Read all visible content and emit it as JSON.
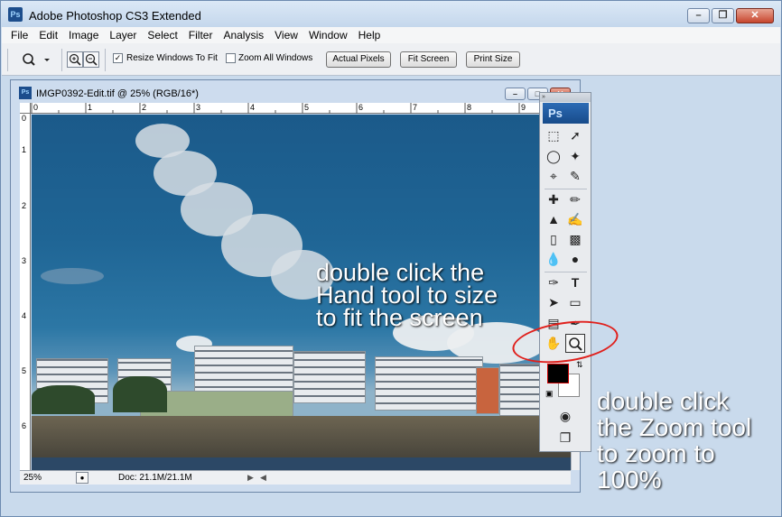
{
  "app": {
    "title": "Adobe Photoshop CS3 Extended",
    "icon_label": "Ps"
  },
  "menu": [
    "File",
    "Edit",
    "Image",
    "Layer",
    "Select",
    "Filter",
    "Analysis",
    "View",
    "Window",
    "Help"
  ],
  "options": {
    "resize_windows": {
      "label": "Resize Windows To Fit",
      "checked": true
    },
    "zoom_all": {
      "label": "Zoom All Windows",
      "checked": false
    },
    "actual_pixels": "Actual Pixels",
    "fit_screen": "Fit Screen",
    "print_size": "Print Size"
  },
  "document": {
    "icon_label": "Ps",
    "title": "IMGP0392-Edit.tif @ 25% (RGB/16*)",
    "ruler_top": [
      "0",
      "1",
      "2",
      "3",
      "4",
      "5",
      "6",
      "7",
      "8",
      "9"
    ],
    "ruler_left": [
      "0",
      "1",
      "2",
      "3",
      "4",
      "5",
      "6"
    ],
    "status_zoom": "25%",
    "status_doc": "Doc: 21.1M/21.1M"
  },
  "annotations": {
    "hand_line1": "double click the",
    "hand_line2": "Hand tool to size",
    "hand_line3": "to fit the screen",
    "zoom_line1": "double click",
    "zoom_line2": "the Zoom tool",
    "zoom_line3": "to zoom to",
    "zoom_line4": "100%"
  },
  "toolbox": {
    "logo": "Ps",
    "grip": "»",
    "foreground_color": "#000000",
    "background_color": "#ffffff"
  },
  "colors": {
    "highlight_ellipse": "#e0201c"
  }
}
